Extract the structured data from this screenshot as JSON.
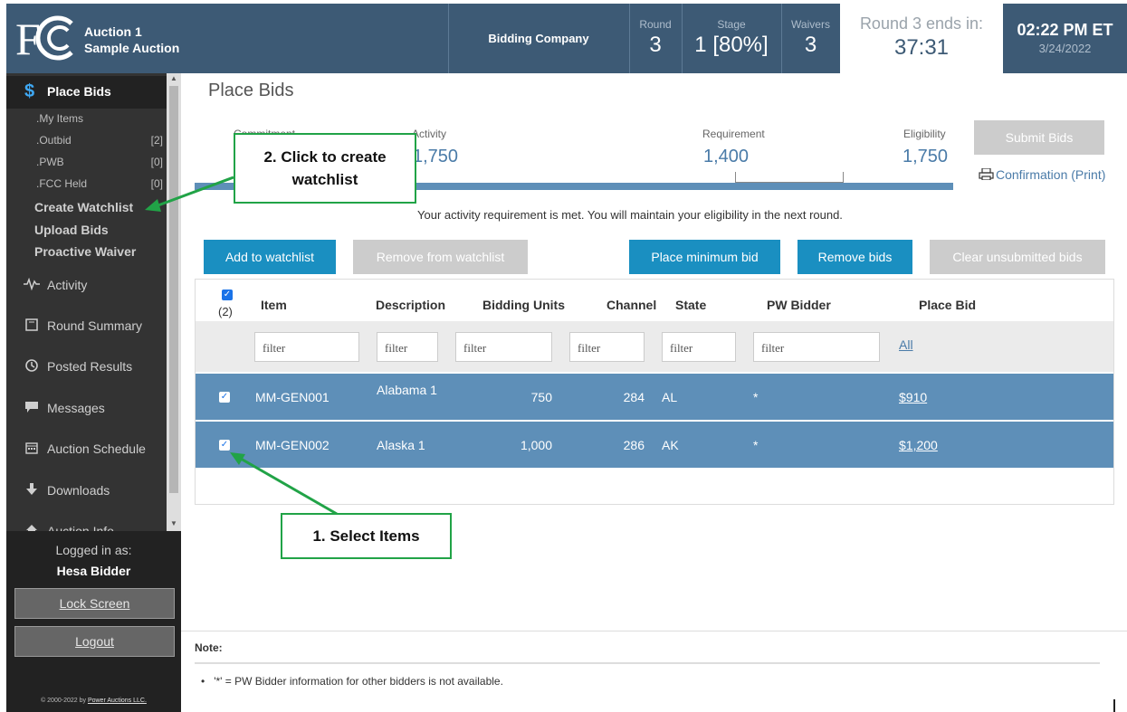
{
  "header": {
    "auction_line1": "Auction 1",
    "auction_line2": "Sample Auction",
    "bidding_company": "Bidding Company",
    "round_label": "Round",
    "round_value": "3",
    "stage_label": "Stage",
    "stage_value": "1 [80%]",
    "waivers_label": "Waivers",
    "waivers_value": "3",
    "round_ends_label": "Round 3 ends in:",
    "round_ends_value": "37:31",
    "clock_time": "02:22 PM ET",
    "clock_date": "3/24/2022"
  },
  "sidebar": {
    "active_label": "Place Bids",
    "sub_items": [
      {
        "label": ".My Items",
        "count": ""
      },
      {
        "label": ".Outbid",
        "count": "[2]"
      },
      {
        "label": ".PWB",
        "count": "[0]"
      },
      {
        "label": ".FCC Held",
        "count": "[0]"
      }
    ],
    "links": [
      "Create Watchlist",
      "Upload Bids",
      "Proactive Waiver"
    ],
    "items": [
      {
        "label": "Activity",
        "icon": "activity-icon"
      },
      {
        "label": "Round Summary",
        "icon": "book-icon"
      },
      {
        "label": "Posted Results",
        "icon": "clock-icon"
      },
      {
        "label": "Messages",
        "icon": "message-icon"
      },
      {
        "label": "Auction Schedule",
        "icon": "calendar-icon"
      },
      {
        "label": "Downloads",
        "icon": "download-icon"
      },
      {
        "label": "Auction Info",
        "icon": "home-icon"
      }
    ],
    "logged_in_label": "Logged in as:",
    "user_name": "Hesa Bidder",
    "lock_screen": "Lock Screen",
    "logout": "Logout",
    "copyright_prefix": "© 2000-2022 by ",
    "copyright_link": "Power Auctions LLC."
  },
  "main": {
    "title": "Place Bids",
    "metrics": {
      "commitment_label": "Commitment",
      "activity_label": "Activity",
      "activity_value": "1,750",
      "requirement_label": "Requirement",
      "requirement_value": "1,400",
      "eligibility_label": "Eligibility",
      "eligibility_value": "1,750"
    },
    "submit_label": "Submit Bids",
    "confirmation_label": "Confirmation  (Print)",
    "info_message": "Your activity requirement is met. You will maintain your eligibility in the next round.",
    "buttons": {
      "add_watchlist": "Add to watchlist",
      "remove_watchlist": "Remove from watchlist",
      "place_min": "Place minimum bid",
      "remove_bids": "Remove bids",
      "clear_unsubmitted": "Clear unsubmitted bids"
    },
    "table": {
      "selected_count": "(2)",
      "columns": [
        "Item",
        "Description",
        "Bidding Units",
        "Channel",
        "State",
        "PW Bidder",
        "Place Bid"
      ],
      "filter_placeholder": "filter",
      "all_link": "All",
      "rows": [
        {
          "item": "MM-GEN001",
          "description": "Alabama 1",
          "units": "750",
          "channel": "284",
          "state": "AL",
          "pw": "*",
          "bid": "$910"
        },
        {
          "item": "MM-GEN002",
          "description": "Alaska 1",
          "units": "1,000",
          "channel": "286",
          "state": "AK",
          "pw": "*",
          "bid": "$1,200"
        }
      ]
    },
    "note_label": "Note:",
    "note_text": "'*' = PW Bidder information for other bidders is not available."
  },
  "annotations": {
    "callout_watchlist": "2. Click to create watchlist",
    "callout_select": "1.  Select Items"
  },
  "colors": {
    "header_bg": "#3d5a75",
    "sidebar_bg": "#333333",
    "accent_blue": "#1a8fc1",
    "selected_row": "#5e8fb8",
    "annotation_green": "#21a347"
  }
}
